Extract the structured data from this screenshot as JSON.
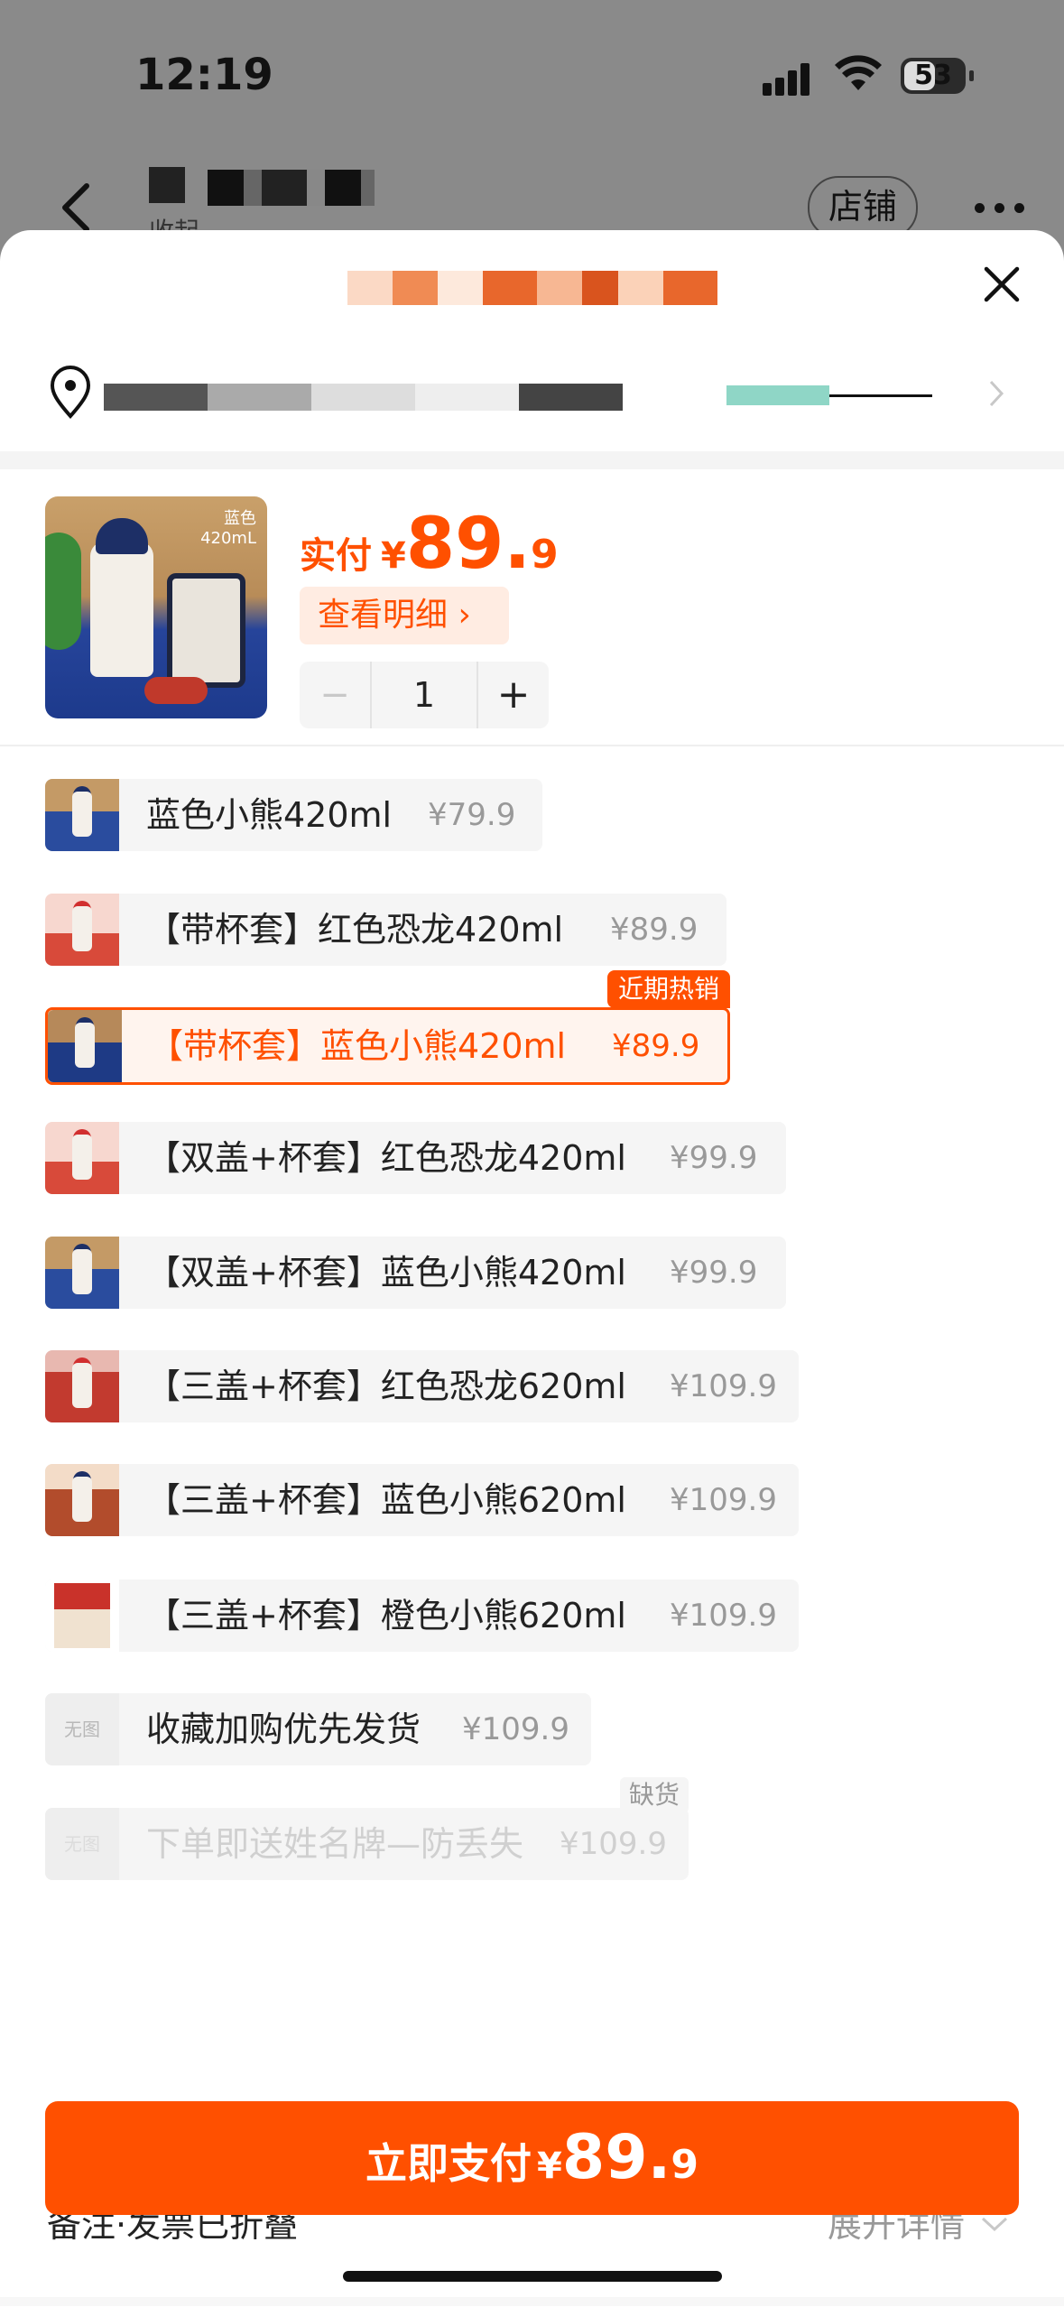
{
  "status_bar": {
    "time": "12:19",
    "battery": "53"
  },
  "header": {
    "shop_subtitle": "收起",
    "shop_button": "店铺"
  },
  "product": {
    "thumb_tag_line1": "蓝色",
    "thumb_tag_line2": "420mL",
    "price_label": "实付",
    "currency": "¥",
    "price_int": "89.",
    "price_dec": "9",
    "detail_button": "查看明细 ›",
    "quantity": "1",
    "minus": "−",
    "plus": "+"
  },
  "skus": [
    {
      "name": "蓝色小熊420ml",
      "price": "¥79.9",
      "state": "normal"
    },
    {
      "name": "【带杯套】红色恐龙420ml",
      "price": "¥89.9",
      "state": "normal"
    },
    {
      "name": "【带杯套】蓝色小熊420ml",
      "price": "¥89.9",
      "state": "selected",
      "badge": "近期热销"
    },
    {
      "name": "【双盖+杯套】红色恐龙420ml",
      "price": "¥99.9",
      "state": "normal"
    },
    {
      "name": "【双盖+杯套】蓝色小熊420ml",
      "price": "¥99.9",
      "state": "normal"
    },
    {
      "name": "【三盖+杯套】红色恐龙620ml",
      "price": "¥109.9",
      "state": "normal"
    },
    {
      "name": "【三盖+杯套】蓝色小熊620ml",
      "price": "¥109.9",
      "state": "normal"
    },
    {
      "name": "【三盖+杯套】橙色小熊620ml",
      "price": "¥109.9",
      "state": "normal"
    },
    {
      "name": "收藏加购优先发货",
      "price": "¥109.9",
      "state": "normal",
      "no_image": "无图"
    },
    {
      "name": "下单即送姓名牌—防丢失",
      "price": "¥109.9",
      "state": "disabled",
      "no_image": "无图",
      "badge": "缺货"
    }
  ],
  "notes": {
    "label": "备注·发票已折叠",
    "expand": "展开详情"
  },
  "pay": {
    "label": "立即支付",
    "currency": "¥",
    "int": "89.",
    "dec": "9"
  },
  "colors": {
    "accent": "#ff5000",
    "accent_bg": "#ffece2",
    "chip_bg": "#f5f5f5"
  }
}
